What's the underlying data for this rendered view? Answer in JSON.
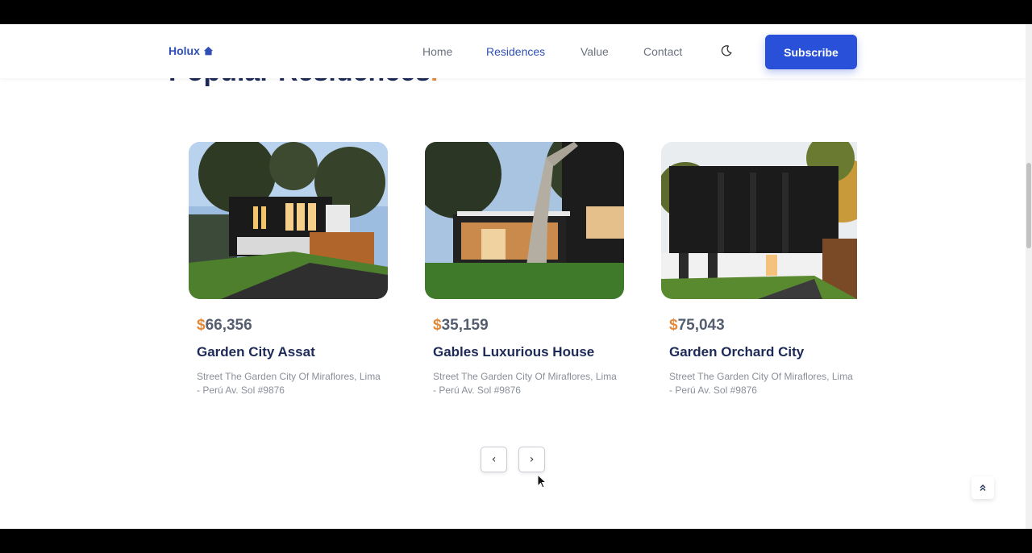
{
  "header": {
    "logo": "Holux",
    "logo_icon": "home-icon",
    "nav": [
      {
        "label": "Home",
        "active": false
      },
      {
        "label": "Residences",
        "active": true
      },
      {
        "label": "Value",
        "active": false
      },
      {
        "label": "Contact",
        "active": false
      }
    ],
    "theme_icon": "moon-icon",
    "subscribe_label": "Subscribe"
  },
  "section": {
    "title": "Popular Residences",
    "title_dot": "."
  },
  "cards": [
    {
      "currency": "$",
      "price": "66,356",
      "title": "Garden City Assat",
      "address": "Street The Garden City Of Miraflores, Lima - Perú Av. Sol #9876"
    },
    {
      "currency": "$",
      "price": "35,159",
      "title": "Gables Luxurious House",
      "address": "Street The Garden City Of Miraflores, Lima - Perú Av. Sol #9876"
    },
    {
      "currency": "$",
      "price": "75,043",
      "title": "Garden Orchard City",
      "address": "Street The Garden City Of Miraflores, Lima - Perú Av. Sol #9876"
    }
  ],
  "controls": {
    "prev_icon": "chevron-left-icon",
    "next_icon": "chevron-right-icon",
    "prev_glyph": "‹",
    "next_glyph": "›",
    "scroll_up_glyph": "⌃",
    "scroll_up_icon": "double-chevron-up-icon"
  },
  "colors": {
    "accent": "#2950d8",
    "brand_text": "#1d2a57",
    "highlight": "#e4893a"
  }
}
